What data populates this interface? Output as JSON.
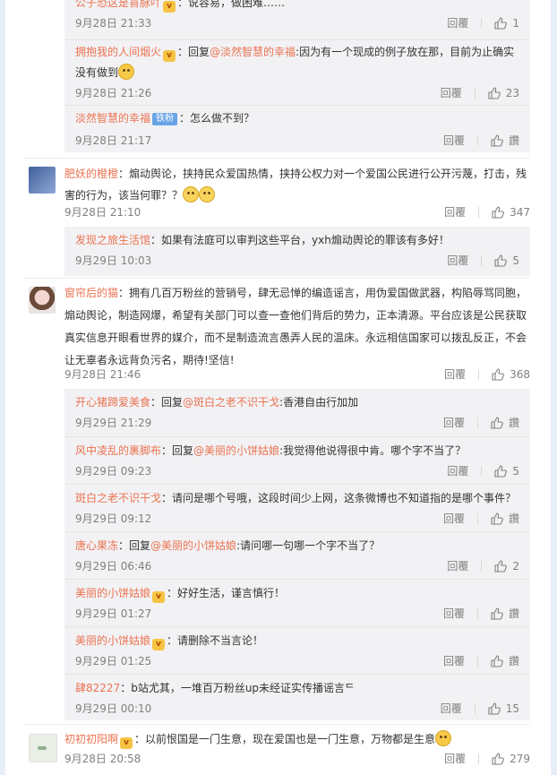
{
  "actions": {
    "reply": "回覆",
    "like_word": "讚"
  },
  "blocks": [
    {
      "kind": "replies",
      "replies": [
        {
          "nick": "公子恐这是喜脉吖",
          "badge": "v",
          "prefix": "：",
          "text": "说容易，做困难……",
          "time": "9月28日 21:33",
          "likes": "1"
        },
        {
          "nick": "拥抱我的人间烟火",
          "badge": "v",
          "prefix": "：回复",
          "at": "@淡然智慧的幸福",
          "text": ":因为有一个现成的例子放在那，目前为止确实没有做到",
          "emoji": "sweat",
          "time": "9月28日 21:26",
          "likes": "23",
          "two_line": true
        },
        {
          "nick": "淡然智慧的幸福",
          "badge": "fan",
          "badge_text": "铁粉",
          "prefix": "：",
          "text": "怎么做不到？",
          "time": "9月28日 21:17",
          "likes": "讚"
        }
      ]
    },
    {
      "kind": "comment",
      "avatar": "blue",
      "nick": "肥妖的橙橙",
      "text": "：煽动舆论，挟持民众爱国热情，挟持公权力对一个爱国公民进行公开污蔑，打击，残害的行为，该当何罪？？",
      "emoji": "cry",
      "time": "9月28日 21:10",
      "likes": "347"
    },
    {
      "kind": "replies",
      "replies": [
        {
          "nick": "发现之旅生活馆",
          "prefix": "：",
          "text": "如果有法庭可以审判这些平台，yxh煽动舆论的罪该有多好！",
          "time": "9月29日 10:03",
          "likes": "5"
        }
      ]
    },
    {
      "kind": "comment",
      "avatar": "girl",
      "nick": "窗帘后的猫",
      "text": "：拥有几百万粉丝的营销号，肆无忌惮的编造谣言，用伪爱国做武器，构陷辱骂同胞，煽动舆论，制造网爆，希望有关部门可以查一查他们背后的势力，正本清源。平台应该是公民获取真实信息开眼看世界的媒介，而不是制造流言愚弄人民的温床。永远相信国家可以拨乱反正，不会让无辜者永远背负污名，期待!坚信!",
      "time": "9月28日 21:46",
      "likes": "368"
    },
    {
      "kind": "replies",
      "replies": [
        {
          "nick": "开心猪蹄爱美食",
          "prefix": "：回复",
          "at": "@斑白之老不识干戈",
          "text": ":香港自由行加加",
          "time": "9月29日 21:29",
          "likes": "讚"
        },
        {
          "nick": "风中凌乱的裹脚布",
          "prefix": "：回复",
          "at": "@美丽的小饼姑娘",
          "text": ":我觉得他说得很中肯。哪个字不当了？",
          "time": "9月29日 09:23",
          "likes": "5"
        },
        {
          "nick": "斑白之老不识干戈",
          "prefix": "：",
          "text": "请问是哪个号哦，这段时间少上网，这条微博也不知道指的是哪个事件？",
          "time": "9月29日 09:12",
          "likes": "讚"
        },
        {
          "nick": "唐心果冻",
          "prefix": "：回复",
          "at": "@美丽的小饼姑娘",
          "text": ":请问哪一句哪一个字不当了？",
          "time": "9月29日 06:46",
          "likes": "2"
        },
        {
          "nick": "美丽的小饼姑娘",
          "badge": "v",
          "prefix": "：",
          "text": "好好生活，谨言慎行！",
          "time": "9月29日 01:27",
          "likes": "讚"
        },
        {
          "nick": "美丽的小饼姑娘",
          "badge": "v",
          "prefix": "：",
          "text": "请删除不当言论！",
          "time": "9月29日 01:25",
          "likes": "讚"
        },
        {
          "nick": "肆82227",
          "prefix": "：",
          "text": "b站尤其，一堆百万粉丝up未经证实传播谣言ᄃ",
          "time": "9月29日 00:10",
          "likes": "15"
        }
      ]
    },
    {
      "kind": "comment",
      "avatar": "pale",
      "nick": "初初初阳啊",
      "badge": "v",
      "text": "：以前恨国是一门生意，现在爱国也是一门生意，万物都是生意",
      "emoji": "laugh",
      "time": "9月28日 20:58",
      "likes": "279"
    }
  ],
  "colors": {
    "link": "#eb7350",
    "reply_bg": "#f2f2f5",
    "muted": "#808080"
  }
}
